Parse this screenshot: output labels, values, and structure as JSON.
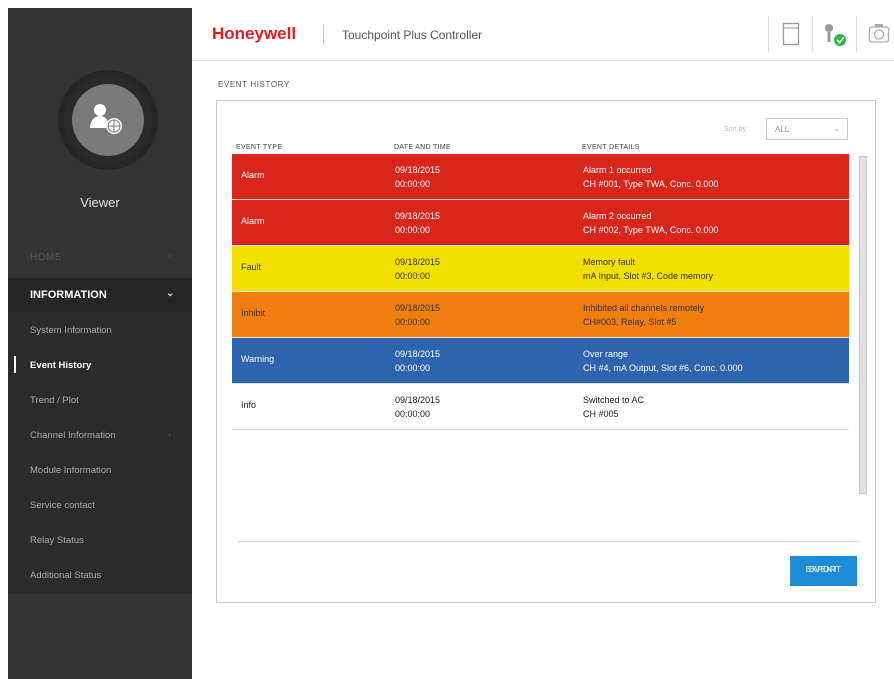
{
  "header": {
    "brand": "Honeywell",
    "product": "Touchpoint Plus Controller"
  },
  "sidebar": {
    "role": "Viewer",
    "home": "HOME",
    "section": "INFORMATION",
    "items": [
      {
        "label": "System Information"
      },
      {
        "label": "Event History",
        "active": true
      },
      {
        "label": "Trend / Plot"
      },
      {
        "label": "Channel Information",
        "has_chevron": true
      },
      {
        "label": "Module Information"
      },
      {
        "label": "Service contact"
      },
      {
        "label": "Relay Status"
      },
      {
        "label": "Additional Status"
      }
    ]
  },
  "page": {
    "title": "EVENT HISTORY",
    "sort_label": "Sort by",
    "sort_value": "ALL",
    "columns": [
      "EVENT TYPE",
      "DATE AND TIME",
      "EVENT DETAILS"
    ],
    "export_line1": "EXPORT",
    "export_line2": "EVENT"
  },
  "events": [
    {
      "type": "Alarm",
      "date": "09/18/2015",
      "time": "00:00:00",
      "detail1": "Alarm 1 occurred",
      "detail2": "CH #001, Type TWA, Conc. 0.000",
      "bg": "#d9261c",
      "fg": "#ffffff"
    },
    {
      "type": "Alarm",
      "date": "09/18/2015",
      "time": "00:00:00",
      "detail1": "Alarm 2 occurred",
      "detail2": "CH #002, Type TWA, Conc. 0.000",
      "bg": "#d9261c",
      "fg": "#ffffff"
    },
    {
      "type": "Fault",
      "date": "09/18/2015",
      "time": "00:00:00",
      "detail1": "Memory fault",
      "detail2": "mA Input, Slot #3, Code memory",
      "bg": "#f2e000",
      "fg": "#333333"
    },
    {
      "type": "Inhibit",
      "date": "09/18/2015",
      "time": "00:00:00",
      "detail1": "Inhibited all channels remotely",
      "detail2": "CH#003, Relay, Slot #5",
      "bg": "#f07f10",
      "fg": "#333333"
    },
    {
      "type": "Warning",
      "date": "09/18/2015",
      "time": "00:00:00",
      "detail1": "Over range",
      "detail2": "CH #4, mA Output, Slot #6, Conc. 0.000",
      "bg": "#2e63ae",
      "fg": "#ffffff"
    },
    {
      "type": "Info",
      "date": "09/18/2015",
      "time": "00:00:00",
      "detail1": "Switched to AC",
      "detail2": "CH #005",
      "bg": "#ffffff",
      "fg": "#222222"
    }
  ],
  "icons": {
    "avatar": "user-globe-icon",
    "document": "document-icon",
    "connection": "sensor-ok-icon",
    "camera": "camera-icon"
  }
}
